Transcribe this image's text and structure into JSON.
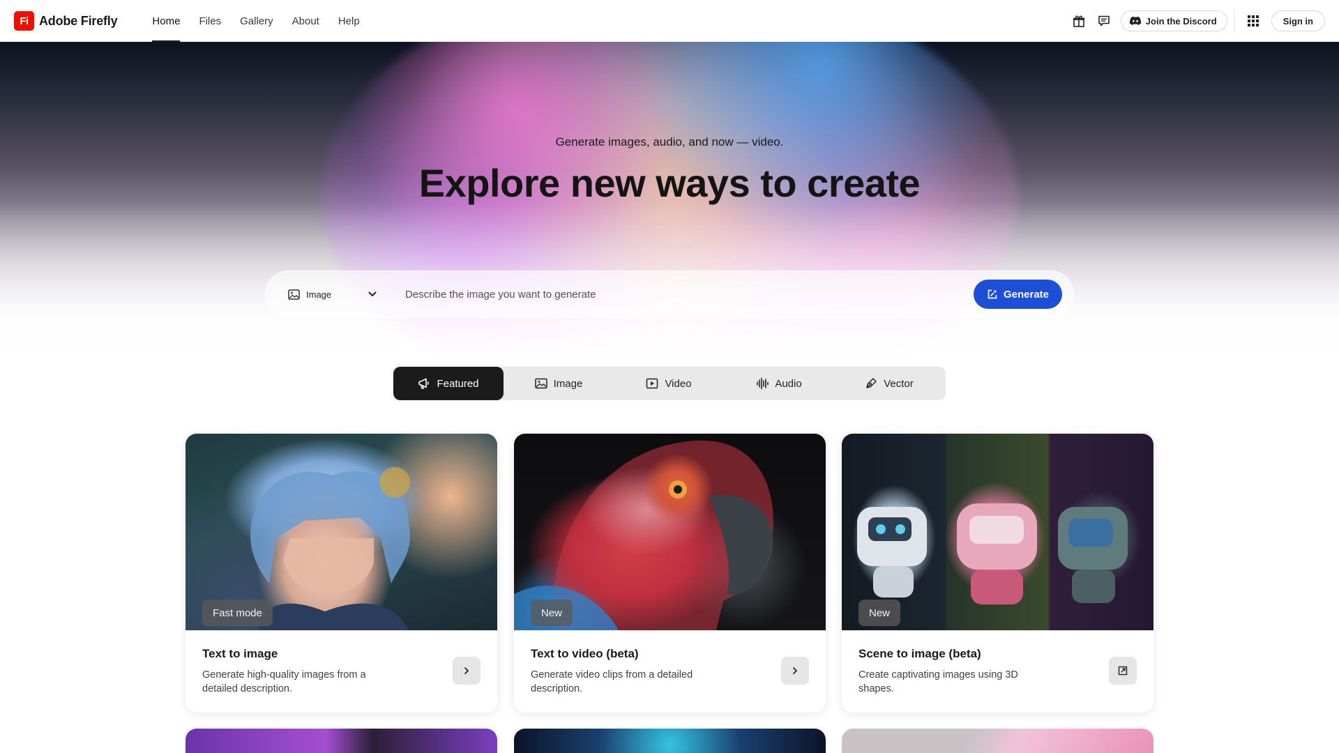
{
  "brand": {
    "logo": "Fi",
    "name": "Adobe Firefly",
    "color": "#eb1000"
  },
  "nav": {
    "links": [
      {
        "label": "Home",
        "active": true
      },
      {
        "label": "Files",
        "active": false
      },
      {
        "label": "Gallery",
        "active": false
      },
      {
        "label": "About",
        "active": false
      },
      {
        "label": "Help",
        "active": false
      }
    ],
    "right": {
      "gift_icon": "gift-icon",
      "feedback_icon": "chat-bubble-icon",
      "discord_label": "Join the Discord",
      "apps_icon": "app-grid-icon",
      "signin_label": "Sign in"
    }
  },
  "hero": {
    "subtitle": "Generate images, audio, and now — video.",
    "title": "Explore new ways to create"
  },
  "prompt": {
    "type_label": "Image",
    "placeholder": "Describe the image you want to generate",
    "value": "",
    "generate_label": "Generate",
    "accent": "#1d4fd6"
  },
  "tabs": [
    {
      "label": "Featured",
      "icon": "megaphone-icon",
      "active": true
    },
    {
      "label": "Image",
      "icon": "image-icon",
      "active": false
    },
    {
      "label": "Video",
      "icon": "video-icon",
      "active": false
    },
    {
      "label": "Audio",
      "icon": "waveform-icon",
      "active": false
    },
    {
      "label": "Vector",
      "icon": "pen-icon",
      "active": false
    }
  ],
  "cards": [
    {
      "badge": "Fast mode",
      "title": "Text to image",
      "description": "Generate high-quality images from a detailed description.",
      "action_icon": "chevron-right-icon"
    },
    {
      "badge": "New",
      "title": "Text to video (beta)",
      "description": "Generate video clips from a detailed description.",
      "action_icon": "chevron-right-icon"
    },
    {
      "badge": "New",
      "title": "Scene to image (beta)",
      "description": "Create captivating images using 3D shapes.",
      "action_icon": "open-external-icon"
    }
  ]
}
